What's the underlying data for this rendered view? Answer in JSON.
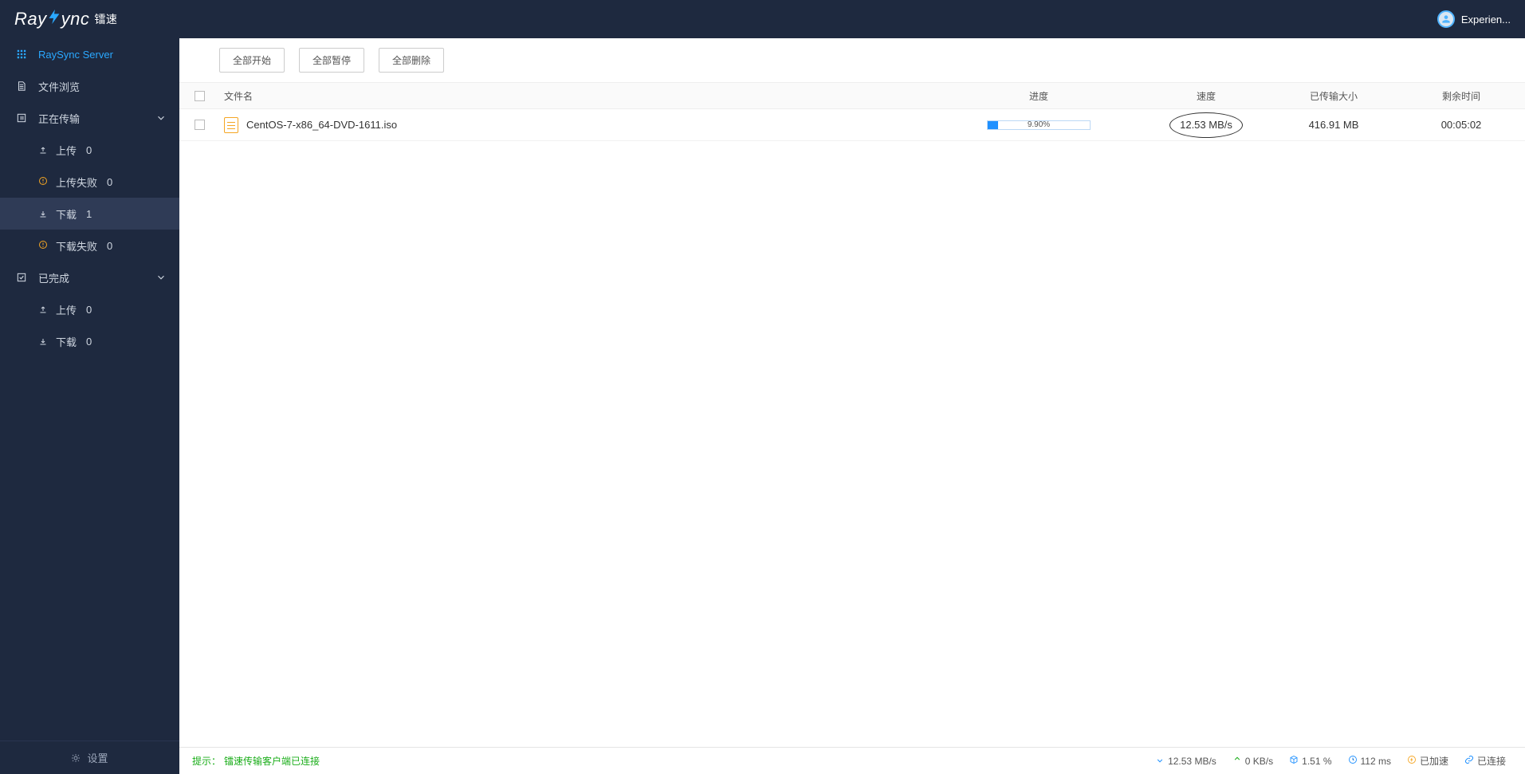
{
  "header": {
    "logo_main": "Ray",
    "logo_tail": "ync",
    "logo_cn": "镭速",
    "user_label": "Experien..."
  },
  "sidebar": {
    "server": "RaySync Server",
    "browse": "文件浏览",
    "transferring": "正在传输",
    "upload": "上传",
    "upload_count": "0",
    "upload_fail": "上传失败",
    "upload_fail_count": "0",
    "download": "下载",
    "download_count": "1",
    "download_fail": "下载失败",
    "download_fail_count": "0",
    "completed": "已完成",
    "c_upload": "上传",
    "c_upload_count": "0",
    "c_download": "下载",
    "c_download_count": "0",
    "settings": "设置"
  },
  "toolbar": {
    "start_all": "全部开始",
    "pause_all": "全部暂停",
    "delete_all": "全部删除"
  },
  "table": {
    "h_name": "文件名",
    "h_progress": "进度",
    "h_speed": "速度",
    "h_size": "已传输大小",
    "h_time": "剩余时间",
    "rows": [
      {
        "name": "CentOS-7-x86_64-DVD-1611.iso",
        "progress_pct": "9.90%",
        "progress_width": "9.9%",
        "speed": "12.53 MB/s",
        "size": "416.91 MB",
        "time": "00:05:02"
      }
    ]
  },
  "status": {
    "hint_label": "提示：",
    "hint_text": "镭速传输客户端已连接",
    "down_speed": "12.53 MB/s",
    "up_speed": "0 KB/s",
    "loss": "1.51 %",
    "latency": "112 ms",
    "accel": "已加速",
    "conn": "已连接"
  }
}
